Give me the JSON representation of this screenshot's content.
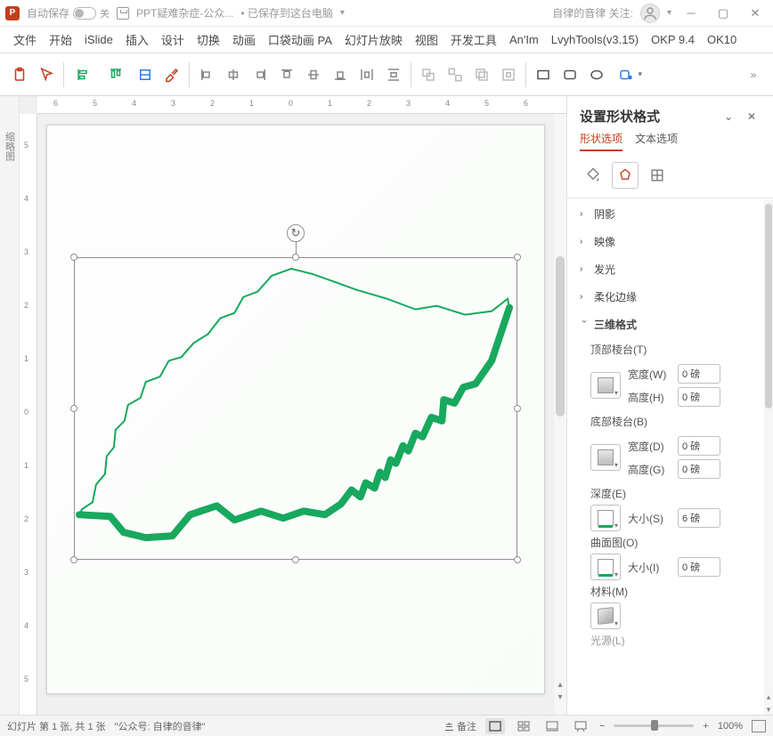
{
  "title": {
    "autosave_label": "自动保存",
    "autosave_state": "关",
    "doc_name": "PPT疑难杂症-公众...",
    "saved_status": "• 已保存到这台电脑 ",
    "author": "自律的音律 关注:"
  },
  "menu": [
    "文件",
    "开始",
    "iSlide",
    "插入",
    "设计",
    "切换",
    "动画",
    "口袋动画 PA",
    "幻灯片放映",
    "视图",
    "开发工具",
    "An'Im",
    "LvyhTools(v3.15)",
    "OKP 9.4",
    "OK10"
  ],
  "outline_label": "缩略图",
  "hruler": [
    "6",
    "5",
    "4",
    "3",
    "2",
    "1",
    "0",
    "1",
    "2",
    "3",
    "4",
    "5",
    "6"
  ],
  "vruler": [
    "5",
    "4",
    "3",
    "2",
    "1",
    "0",
    "1",
    "2",
    "3",
    "4",
    "5"
  ],
  "pane": {
    "title": "设置形状格式",
    "tabs": {
      "shape": "形状选项",
      "text": "文本选项"
    },
    "sections": {
      "shadow": "阴影",
      "reflection": "映像",
      "glow": "发光",
      "soft": "柔化边缘",
      "threed": "三维格式",
      "top_bevel": "顶部棱台(T)",
      "bottom_bevel": "底部棱台(B)",
      "depth": "深度(E)",
      "contour": "曲面图(O)",
      "material": "材料(M)",
      "light": "光源(L)"
    },
    "labels": {
      "width_w": "宽度(W)",
      "height_h": "高度(H)",
      "width_d": "宽度(D)",
      "height_g": "高度(G)",
      "size_s": "大小(S)",
      "size_i": "大小(I)"
    },
    "values": {
      "top_w": "0 磅",
      "top_h": "0 磅",
      "bot_w": "0 磅",
      "bot_h": "0 磅",
      "depth_s": "6 磅",
      "contour_s": "0 磅"
    }
  },
  "status": {
    "slide_info": "幻灯片 第 1 张, 共 1 张",
    "channel": "\"公众号: 自律的音律\"",
    "notes": "备注",
    "zoom_pct": "100%"
  }
}
